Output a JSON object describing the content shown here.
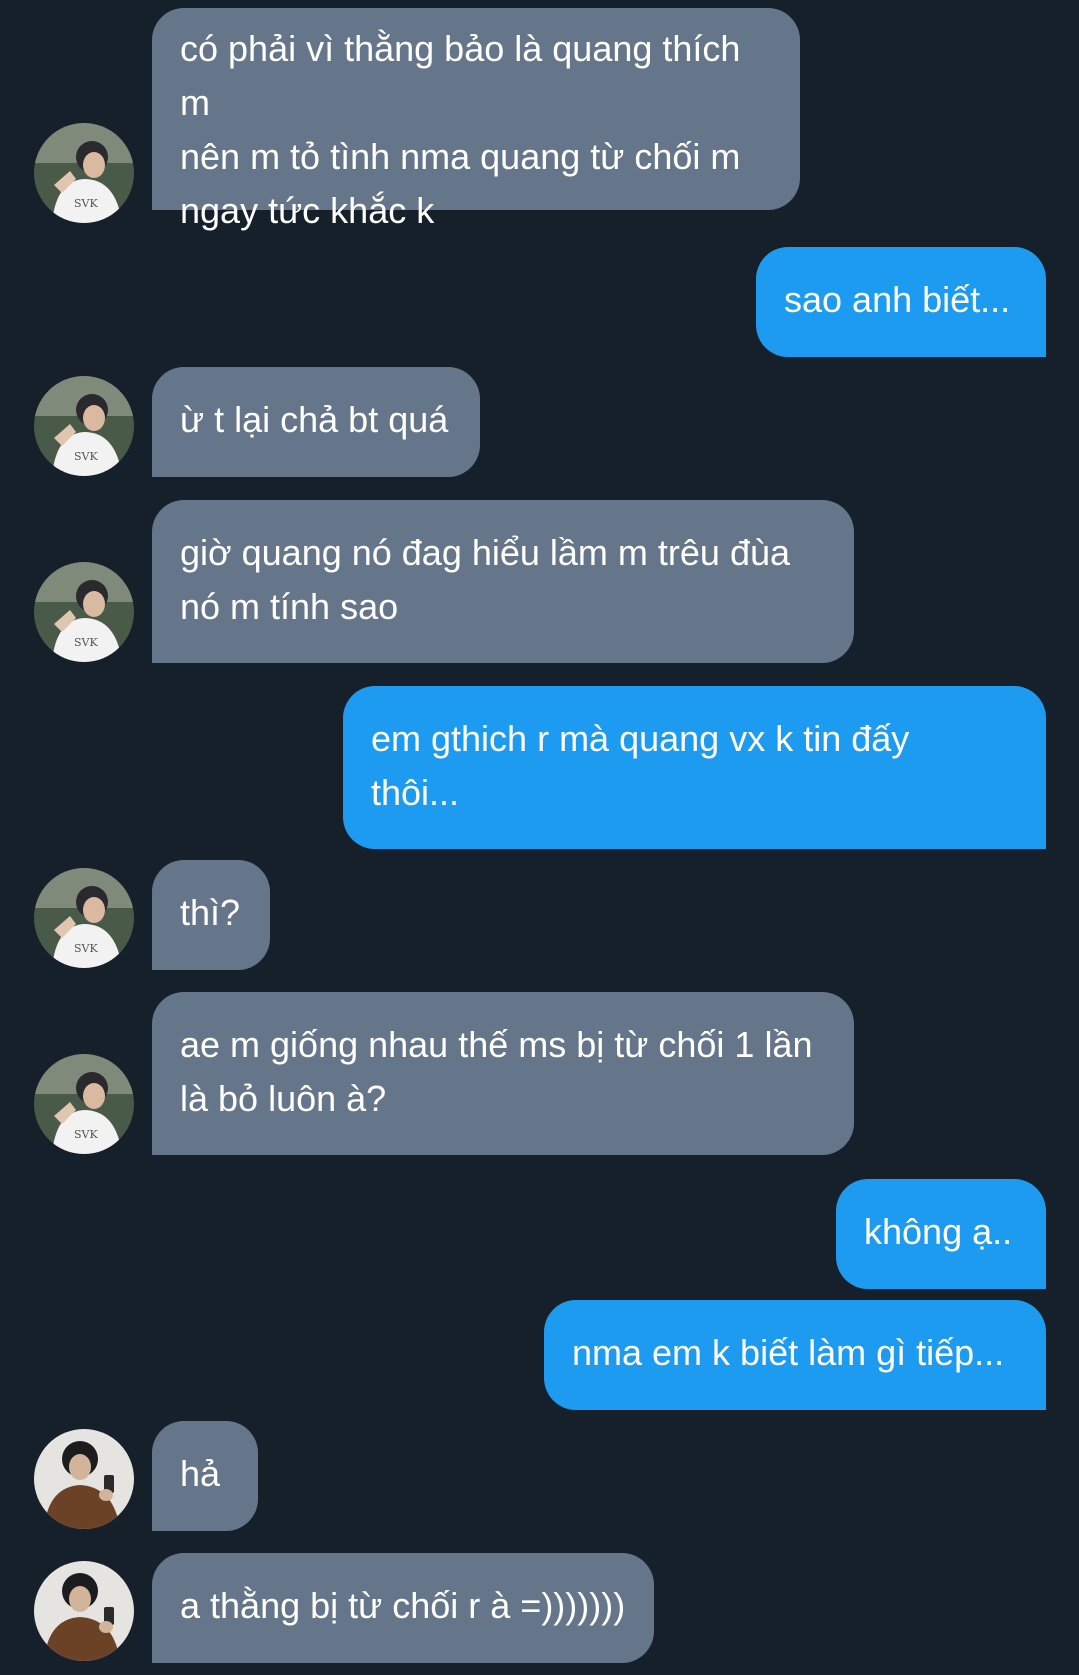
{
  "conversation": {
    "messages": [
      {
        "side": "in",
        "text": "có phải vì thằng bảo là quang thích m\nnên m tỏ tình nma quang từ chối m\nngay tức khắc k",
        "avatar": "avatar-white-shirt"
      },
      {
        "side": "out",
        "text": "sao anh biết..."
      },
      {
        "side": "in",
        "text": "ừ t lại chả bt quá",
        "avatar": "avatar-white-shirt"
      },
      {
        "side": "in",
        "text": "giờ quang nó đag hiểu lầm m trêu đùa\nnó m tính sao",
        "avatar": "avatar-white-shirt"
      },
      {
        "side": "out",
        "text": "em gthich r mà quang vx k tin đấy\nthôi..."
      },
      {
        "side": "in",
        "text": "thì?",
        "avatar": "avatar-white-shirt"
      },
      {
        "side": "in",
        "text": "ae m giống nhau thế ms bị từ chối 1 lần\nlà bỏ luôn à?",
        "avatar": "avatar-white-shirt"
      },
      {
        "side": "out",
        "text": "không ạ.."
      },
      {
        "side": "out",
        "text": "nma em k biết làm gì tiếp..."
      },
      {
        "side": "in",
        "text": "hả",
        "avatar": "avatar-brown-jacket"
      },
      {
        "side": "in",
        "text": "a thằng bị từ chối r à =)))))))",
        "avatar": "avatar-brown-jacket"
      }
    ]
  },
  "theme": {
    "background": "#15202b",
    "incoming_bubble": "#66768a",
    "outgoing_bubble": "#1d9bf0",
    "text": "#ffffff"
  }
}
